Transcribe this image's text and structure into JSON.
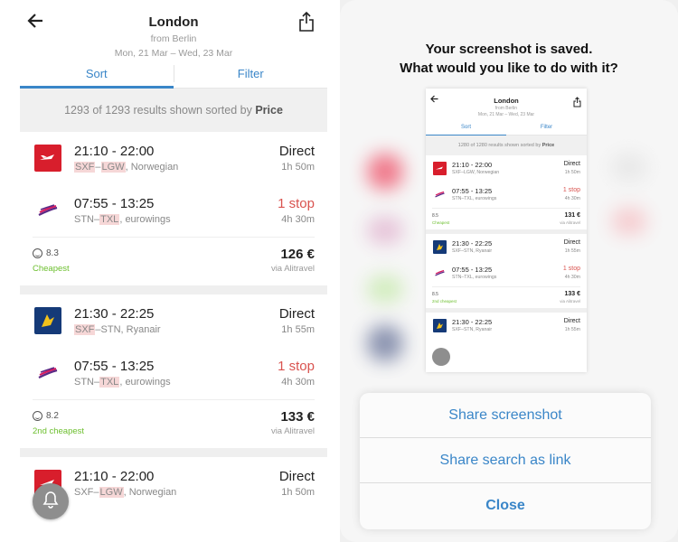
{
  "left": {
    "header": {
      "title": "London",
      "subtitle_from": "from Berlin",
      "dates": "Mon, 21 Mar – Wed, 23 Mar"
    },
    "tabs": [
      {
        "label": "Sort"
      },
      {
        "label": "Filter"
      }
    ],
    "results": {
      "text": "1293 of 1293 results shown sorted by",
      "sort_key": "Price"
    },
    "cards": [
      {
        "legs": [
          {
            "times": "21:10 - 22:00",
            "origin": "SXF",
            "dest": "LGW",
            "airline": "Norwegian",
            "stops": "Direct",
            "duration": "1h 50m",
            "logo": "norwegian"
          },
          {
            "times": "07:55 - 13:25",
            "origin": "STN",
            "dest": "TXL",
            "airline": "eurowings",
            "stops": "1 stop",
            "duration": "4h 30m",
            "logo": "eurowings"
          }
        ],
        "rating": "8.3",
        "badge": "Cheapest",
        "price": "126 €",
        "via": "via Alitravel"
      },
      {
        "legs": [
          {
            "times": "21:30 - 22:25",
            "origin": "SXF",
            "dest": "STN",
            "airline": "Ryanair",
            "stops": "Direct",
            "duration": "1h 55m",
            "logo": "ryanair"
          },
          {
            "times": "07:55 - 13:25",
            "origin": "STN",
            "dest": "TXL",
            "airline": "eurowings",
            "stops": "1 stop",
            "duration": "4h 30m",
            "logo": "eurowings"
          }
        ],
        "rating": "8.2",
        "badge": "2nd cheapest",
        "price": "133 €",
        "via": "via Alitravel"
      },
      {
        "legs": [
          {
            "times": "21:10 - 22:00",
            "origin": "SXF",
            "dest": "LGW",
            "airline": "Norwegian",
            "stops": "Direct",
            "duration": "1h 50m",
            "logo": "norwegian"
          }
        ]
      }
    ]
  },
  "right": {
    "saved_line1": "Your screenshot is saved.",
    "saved_line2": "What would you like to do with it?",
    "thumb": {
      "title": "London",
      "subtitle_from": "from Berlin",
      "dates": "Mon, 21 Mar – Wed, 23 Mar",
      "tab_sort": "Sort",
      "tab_filter": "Filter",
      "results_text": "1280 of 1280 results shown sorted by",
      "results_key": "Price",
      "cards": [
        {
          "legs": [
            {
              "times": "21:10 - 22:00",
              "route": "SXF–LGW, Norwegian",
              "stops": "Direct",
              "duration": "1h 50m"
            },
            {
              "times": "07:55 - 13:25",
              "route": "STN–TXL, eurowings",
              "stops": "1 stop",
              "duration": "4h 30m"
            }
          ],
          "rating": "8.5",
          "badge": "Cheapest",
          "price": "131 €",
          "via": "via Alitravel"
        },
        {
          "legs": [
            {
              "times": "21:30 - 22:25",
              "route": "SXF–STN, Ryanair",
              "stops": "Direct",
              "duration": "1h 55m"
            },
            {
              "times": "07:55 - 13:25",
              "route": "STN–TXL, eurowings",
              "stops": "1 stop",
              "duration": "4h 30m"
            }
          ],
          "rating": "8.5",
          "badge": "2nd cheapest",
          "price": "133 €",
          "via": "via Alitravel"
        },
        {
          "legs": [
            {
              "times": "21:30 - 22:25",
              "route": "SXF–STN, Ryanair",
              "stops": "Direct",
              "duration": "1h 55m"
            }
          ]
        }
      ]
    },
    "sheet": {
      "share_screenshot": "Share screenshot",
      "share_link": "Share search as link",
      "close": "Close"
    }
  },
  "colors": {
    "accent": "#3a86c8",
    "red": "#d9534f",
    "green": "#6cbf2e"
  },
  "icons": {
    "back": "back-arrow-icon",
    "share": "share-icon",
    "bell": "bell-icon",
    "rating": "smiley-icon"
  }
}
